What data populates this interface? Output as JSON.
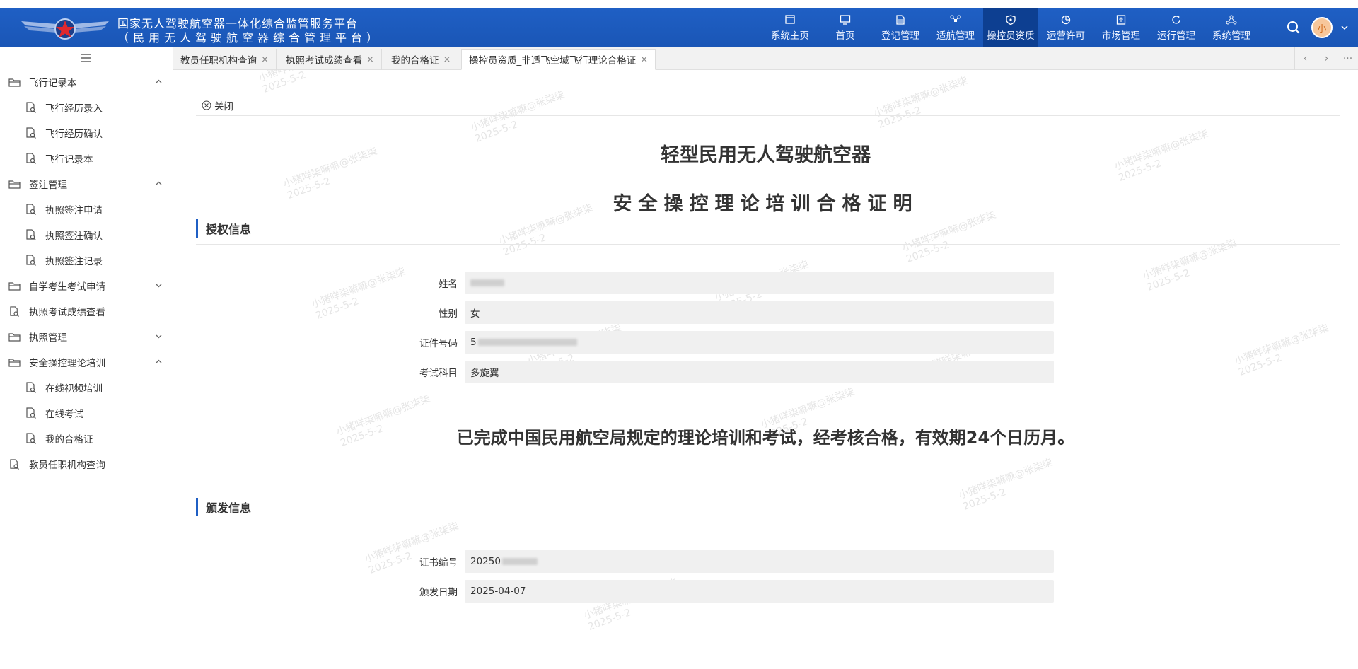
{
  "header": {
    "title_line1": "国家无人驾驶航空器一体化综合监管服务平台",
    "title_line2": "（民用无人驾驶航空器综合管理平台）",
    "nav": [
      {
        "label": "系统主页",
        "icon": "window-icon"
      },
      {
        "label": "首页",
        "icon": "monitor-icon"
      },
      {
        "label": "登记管理",
        "icon": "document-icon"
      },
      {
        "label": "适航管理",
        "icon": "drone-icon"
      },
      {
        "label": "操控员资质",
        "icon": "shield-icon",
        "active": true
      },
      {
        "label": "运营许可",
        "icon": "pie-icon"
      },
      {
        "label": "市场管理",
        "icon": "upload-icon"
      },
      {
        "label": "运行管理",
        "icon": "refresh-icon"
      },
      {
        "label": "系统管理",
        "icon": "cluster-icon"
      }
    ],
    "avatar_text": "小"
  },
  "sidebar": {
    "groups": [
      {
        "label": "飞行记录本",
        "expanded": true,
        "items": [
          "飞行经历录入",
          "飞行经历确认",
          "飞行记录本"
        ]
      },
      {
        "label": "签注管理",
        "expanded": true,
        "items": [
          "执照签注申请",
          "执照签注确认",
          "执照签注记录"
        ]
      },
      {
        "label": "自学考生考试申请",
        "expanded": false,
        "items": []
      },
      {
        "label": "执照考试成绩查看",
        "leaf": true,
        "items": []
      },
      {
        "label": "执照管理",
        "expanded": false,
        "items": []
      },
      {
        "label": "安全操控理论培训",
        "expanded": true,
        "items": [
          "在线视频培训",
          "在线考试",
          "我的合格证"
        ]
      },
      {
        "label": "教员任职机构查询",
        "leaf": true,
        "items": []
      }
    ]
  },
  "tabs": [
    {
      "label": "教员任职机构查询"
    },
    {
      "label": "执照考试成绩查看"
    },
    {
      "label": "我的合格证"
    },
    {
      "label": "操控员资质_非适飞空域飞行理论合格证",
      "active": true
    }
  ],
  "content": {
    "close_label": "关闭",
    "title1": "轻型民用无人驾驶航空器",
    "title2": "安全操控理论培训合格证明",
    "auth_section": "授权信息",
    "fields": [
      {
        "label": "姓名",
        "value": "",
        "redacted": true
      },
      {
        "label": "性别",
        "value": "女"
      },
      {
        "label": "证件号码",
        "value": "5",
        "redacted": true
      },
      {
        "label": "考试科目",
        "value": "多旋翼"
      }
    ],
    "statement": "已完成中国民用航空局规定的理论培训和考试，经考核合格，有效期24个日历月。",
    "issue_section": "颁发信息",
    "issue_fields": [
      {
        "label": "证书编号",
        "value": "20250",
        "redacted": true
      },
      {
        "label": "颁发日期",
        "value": "2025-04-07"
      }
    ]
  },
  "watermark": {
    "line1": "小猪咩柒嘛嘛@张柒柒",
    "line2": "2025-5-2"
  }
}
